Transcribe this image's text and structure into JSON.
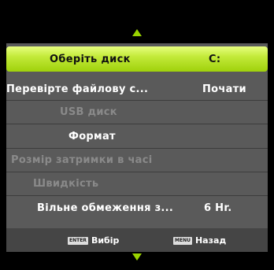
{
  "colors": {
    "accent": "#9fd10b",
    "header_highlight": "#e7ff80",
    "panel_bg": "#5a5a5a",
    "footer_bg": "#454545",
    "disabled_text": "#8a8a8a"
  },
  "nav": {
    "up_icon": "triangle-up",
    "down_icon": "triangle-down"
  },
  "header": {
    "label": "Оберіть диск",
    "value": "C:"
  },
  "menu": {
    "check_fs": {
      "label": "Перевірте файлову с...",
      "value": "Почати"
    },
    "usb_disk": {
      "label": "USB диск"
    },
    "format": {
      "label": "Формат"
    },
    "delay_size": {
      "label": "Розмір затримки в часі"
    },
    "speed": {
      "label": "Швидкість"
    },
    "free_limit": {
      "label": "Вільне обмеження з...",
      "value": "6 Hr."
    }
  },
  "footer": {
    "select_key": "ENTER",
    "select_label": "Вибір",
    "back_key": "MENU",
    "back_label": "Назад"
  }
}
